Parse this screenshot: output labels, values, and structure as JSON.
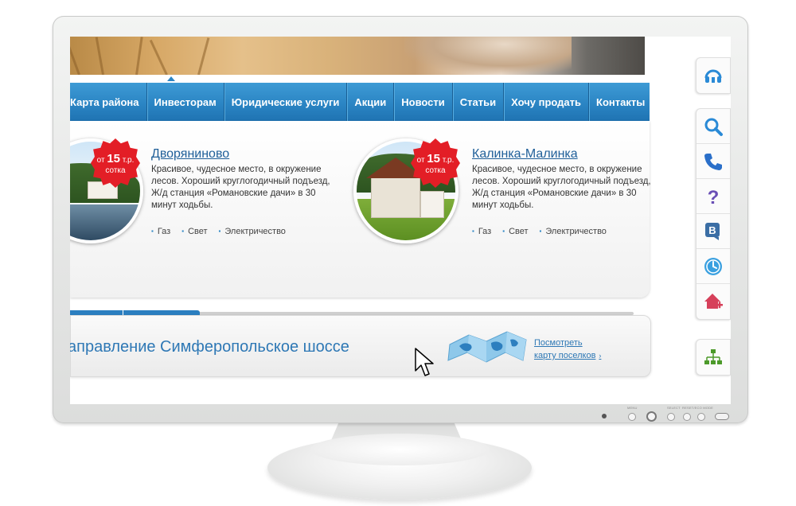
{
  "nav": {
    "items": [
      "Карта района",
      "Инвесторам",
      "Юридические услуги",
      "Акции",
      "Новости",
      "Статьи",
      "Хочу продать",
      "Контакты"
    ]
  },
  "listings": [
    {
      "title": "Дворяниново",
      "price_prefix": "от",
      "price_value": "15",
      "price_unit": "т.р.",
      "price_per": "сотка",
      "description": "Красивое, чудесное место, в окружение лесов. Хороший круглогодичный подъезд, Ж/д станция «Романовские дачи» в 30 минут ходьбы.",
      "features": [
        "Газ",
        "Свет",
        "Электричество"
      ]
    },
    {
      "title": "Калинка-Малинка",
      "price_prefix": "от",
      "price_value": "15",
      "price_unit": "т.р.",
      "price_per": "сотка",
      "description": "Красивое, чудесное место, в окружение лесов. Хороший круглогодичный подъезд, Ж/д станция «Романовские дачи» в 30 минут ходьбы.",
      "features": [
        "Газ",
        "Свет",
        "Электричество"
      ]
    }
  ],
  "slider": {
    "progress": 0.23
  },
  "direction": {
    "text": "аправление Симферопольское шоссе",
    "map_link_line1": "Посмотреть",
    "map_link_line2": "карту поселков",
    "map_link_arrow": "›"
  },
  "side_toolbar": {
    "icons": [
      "headset-icon",
      "search-icon",
      "phone-icon",
      "question-icon",
      "vk-icon",
      "clock-icon",
      "add-house-icon",
      "sitemap-icon"
    ]
  },
  "monitor": {
    "labels": [
      "MENU",
      "SELECT",
      "RESET/ECO MODE"
    ]
  },
  "colors": {
    "nav_blue": "#2b85c4",
    "link_blue": "#1f5f99",
    "badge_red": "#e31e26",
    "side_icon_blue": "#2a8ad6",
    "side_icon_purple": "#6a4fb5",
    "side_icon_red": "#d6405a",
    "side_icon_green": "#4c9a2a"
  }
}
